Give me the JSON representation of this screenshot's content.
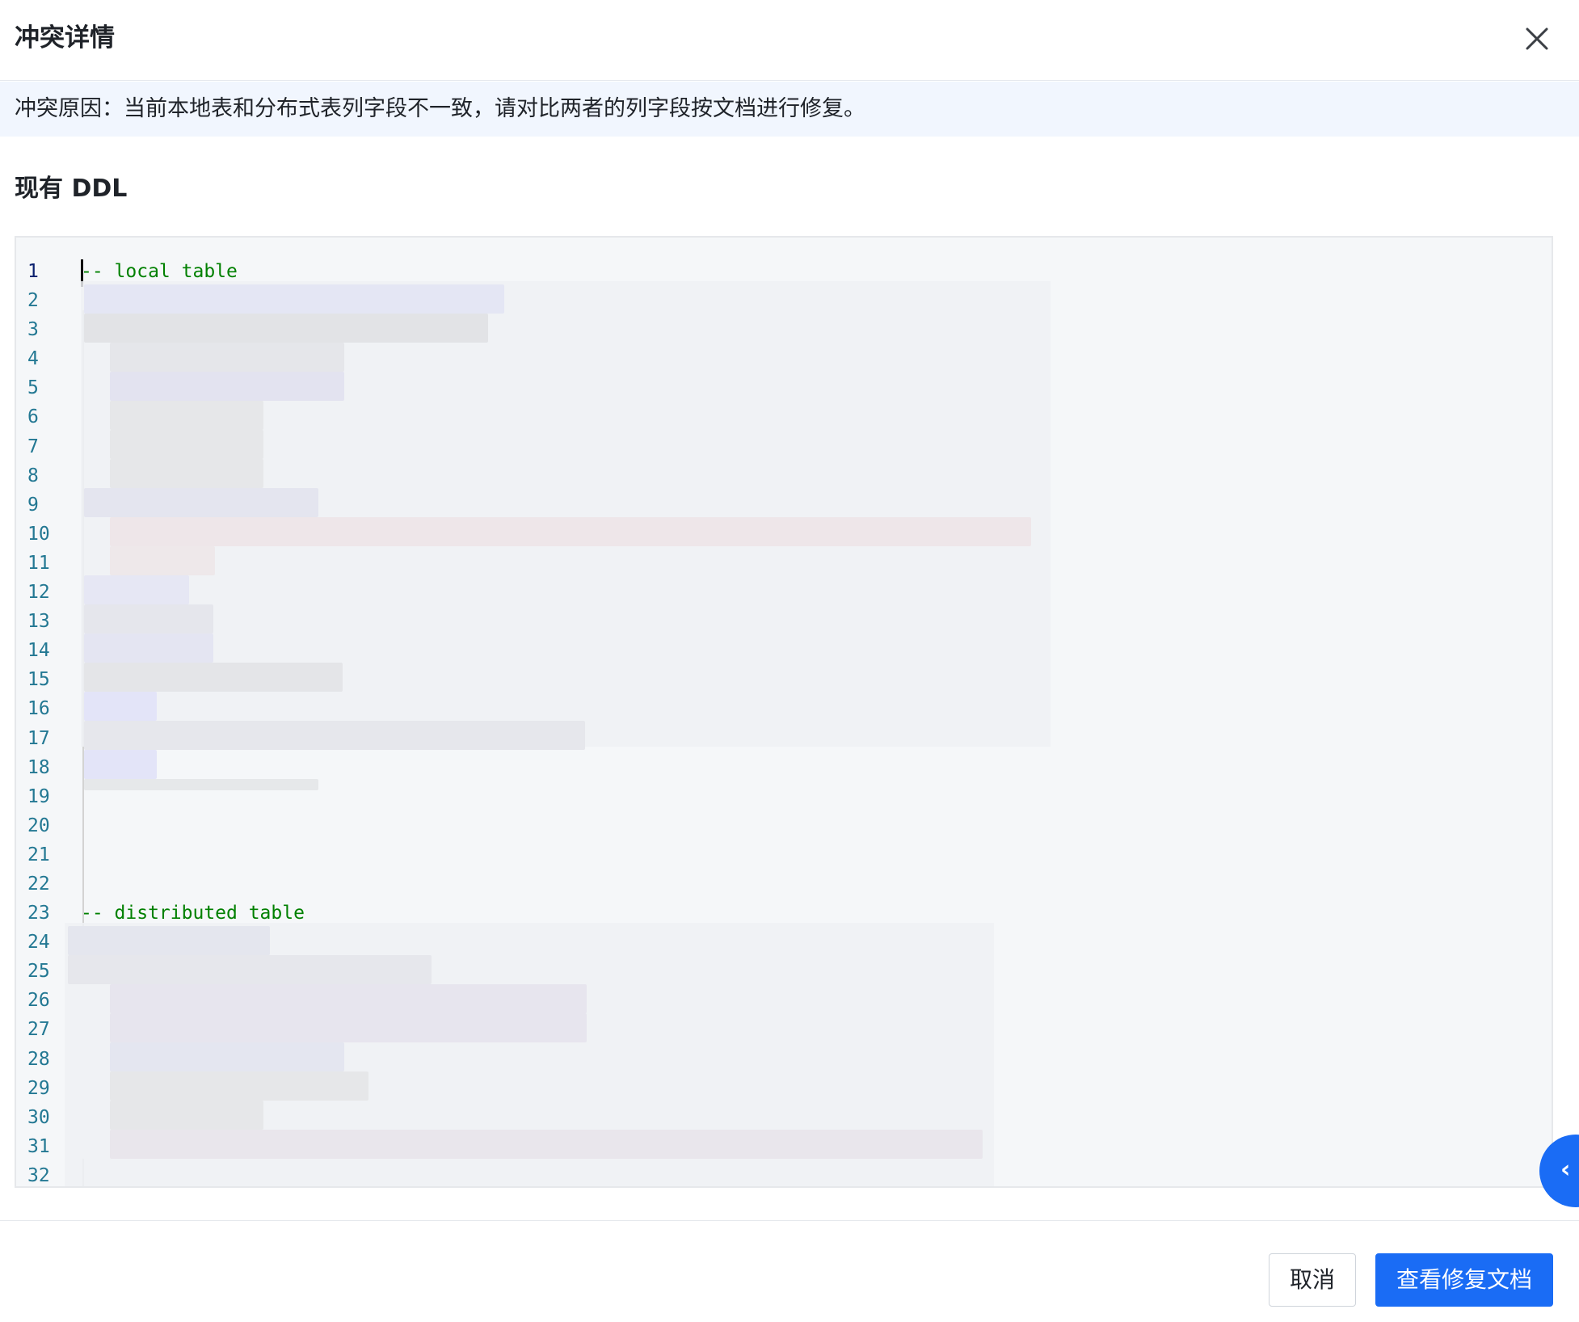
{
  "dialog": {
    "title": "冲突详情",
    "close_icon": "close-icon"
  },
  "notice": {
    "text": "冲突原因：当前本地表和分布式表列字段不一致，请对比两者的列字段按文档进行修复。"
  },
  "section": {
    "title": "现有 DDL"
  },
  "editor": {
    "line_numbers": [
      "1",
      "2",
      "3",
      "4",
      "5",
      "6",
      "7",
      "8",
      "9",
      "10",
      "11",
      "12",
      "13",
      "14",
      "15",
      "16",
      "17",
      "18",
      "19",
      "20",
      "21",
      "22",
      "23",
      "24",
      "25",
      "26",
      "27",
      "28",
      "29",
      "30",
      "31",
      "32"
    ],
    "line1_comment": "-- local table",
    "line23_comment": "-- distributed table"
  },
  "footer": {
    "cancel_label": "取消",
    "primary_label": "查看修复文档"
  },
  "colors": {
    "primary": "#1a6cf5",
    "notice_bg": "#f1f6fe",
    "editor_bg": "#f5f7f9",
    "comment": "#008000",
    "line_number": "#237893"
  }
}
